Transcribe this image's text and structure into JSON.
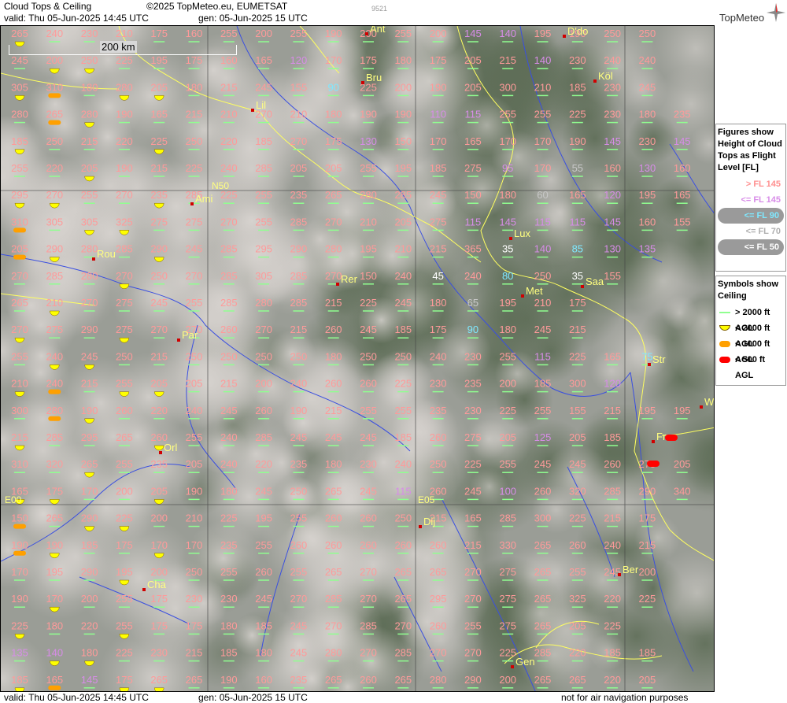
{
  "header": {
    "product": "Cloud Tops & Ceiling",
    "copyright": "©2025 TopMeteo.eu, EUMETSAT",
    "valid": "valid:  Thu  05-Jun-2025  14:45 UTC",
    "gen": "gen: 05-Jun-2025 15 UTC",
    "code": "9521",
    "logo": "TopMeteo"
  },
  "footer": {
    "valid": "valid:  Thu  05-Jun-2025  14:45 UTC",
    "gen": "gen: 05-Jun-2025 15 UTC",
    "disclaimer": "not for air navigation purposes"
  },
  "scale_label": "200 km",
  "grid_labels": {
    "n50": "N50",
    "e00": "E00",
    "e05": "E05"
  },
  "cities": [
    "Ant",
    "D'do",
    "Bru",
    "Köl",
    "Lil",
    "Ami",
    "Lux",
    "Rou",
    "Rer",
    "Saa",
    "Met",
    "Par",
    "Str",
    "W",
    "Fr",
    "Orl",
    "Dij",
    "Cha",
    "Ber",
    "Gen"
  ],
  "legend": {
    "tops_title": "Figures show Height of Cloud Tops as Flight Level  [FL]",
    "tops_items": [
      {
        "label": "> FL 145",
        "color": "#ff9090"
      },
      {
        "label": "<= FL 145",
        "color": "#d88ce8"
      },
      {
        "label": "<= FL 90",
        "color": "#7fe8ff"
      },
      {
        "label": "<= FL 70",
        "color": "#b0b0b0"
      },
      {
        "label": "<= FL 50",
        "color": "#ffffff"
      }
    ],
    "ceiling_title": "Symbols show Ceiling",
    "ceiling_items": [
      {
        "label": "> 2000 ft AGL",
        "color": "#90ff90",
        "shape": "line"
      },
      {
        "label": "< 2000 ft AGL",
        "color": "#ffff00",
        "shape": "half"
      },
      {
        "label": "< 1000 ft AGL",
        "color": "#ffa000",
        "shape": "pill"
      },
      {
        "label": "< 500 ft AGL",
        "color": "#ff0000",
        "shape": "pill"
      }
    ]
  },
  "rows": [
    [
      "265",
      "240",
      "230",
      "210",
      "175",
      "160",
      "255",
      "200",
      "255",
      "190",
      "200",
      "255",
      "200",
      "145",
      "140",
      "195",
      "190",
      "250",
      "250"
    ],
    [
      "245",
      "200",
      "250",
      "225",
      "195",
      "175",
      "160",
      "165",
      "120",
      "170",
      "175",
      "180",
      "175",
      "205",
      "215",
      "140",
      "230",
      "240",
      "240"
    ],
    [
      "305",
      "310",
      "180",
      "280",
      "205",
      "180",
      "215",
      "245",
      "155",
      "90",
      "225",
      "200",
      "190",
      "205",
      "300",
      "210",
      "185",
      "230",
      "245"
    ],
    [
      "280",
      "265",
      "280",
      "190",
      "165",
      "215",
      "210",
      "270",
      "210",
      "180",
      "190",
      "190",
      "110",
      "115",
      "255",
      "255",
      "225",
      "230",
      "180",
      "235"
    ],
    [
      "185",
      "250",
      "215",
      "220",
      "225",
      "250",
      "220",
      "185",
      "270",
      "175",
      "130",
      "150",
      "170",
      "165",
      "170",
      "170",
      "190",
      "145",
      "230",
      "145"
    ],
    [
      "255",
      "220",
      "205",
      "190",
      "215",
      "225",
      "240",
      "285",
      "205",
      "205",
      "255",
      "195",
      "185",
      "275",
      "95",
      "170",
      "55",
      "160",
      "130",
      "160"
    ],
    [
      "295",
      "270",
      "255",
      "270",
      "235",
      "285",
      "225",
      "255",
      "235",
      "265",
      "280",
      "285",
      "245",
      "150",
      "180",
      "60",
      "165",
      "120",
      "195",
      "165"
    ],
    [
      "310",
      "305",
      "305",
      "325",
      "275",
      "275",
      "270",
      "255",
      "285",
      "270",
      "210",
      "205",
      "275",
      "115",
      "145",
      "115",
      "115",
      "145",
      "160",
      "155"
    ],
    [
      "205",
      "290",
      "280",
      "285",
      "290",
      "245",
      "285",
      "295",
      "290",
      "280",
      "195",
      "210",
      "215",
      "365",
      "35",
      "140",
      "85",
      "130",
      "135"
    ],
    [
      "270",
      "285",
      "280",
      "270",
      "250",
      "270",
      "285",
      "305",
      "285",
      "270",
      "150",
      "240",
      "45",
      "240",
      "80",
      "250",
      "35",
      "155"
    ],
    [
      "265",
      "210",
      "270",
      "275",
      "245",
      "255",
      "285",
      "280",
      "285",
      "215",
      "225",
      "245",
      "180",
      "65",
      "195",
      "210",
      "175"
    ],
    [
      "270",
      "275",
      "290",
      "275",
      "270",
      "270",
      "260",
      "270",
      "215",
      "260",
      "245",
      "185",
      "175",
      "90",
      "180",
      "245",
      "215"
    ],
    [
      "255",
      "240",
      "245",
      "250",
      "215",
      "250",
      "250",
      "250",
      "250",
      "180",
      "250",
      "250",
      "240",
      "230",
      "255",
      "115",
      "225",
      "165",
      "75"
    ],
    [
      "210",
      "240",
      "215",
      "255",
      "205",
      "205",
      "215",
      "200",
      "240",
      "260",
      "260",
      "225",
      "230",
      "235",
      "200",
      "185",
      "300",
      "120"
    ],
    [
      "300",
      "280",
      "190",
      "260",
      "220",
      "240",
      "245",
      "260",
      "190",
      "215",
      "255",
      "255",
      "235",
      "230",
      "225",
      "255",
      "155",
      "215",
      "195",
      "195"
    ],
    [
      "215",
      "285",
      "295",
      "265",
      "260",
      "255",
      "240",
      "285",
      "245",
      "245",
      "245",
      "185",
      "260",
      "275",
      "205",
      "125",
      "205",
      "185"
    ],
    [
      "310",
      "320",
      "265",
      "255",
      "235",
      "205",
      "240",
      "220",
      "235",
      "180",
      "230",
      "240",
      "250",
      "225",
      "255",
      "245",
      "245",
      "260",
      "275",
      "205",
      "200"
    ],
    [
      "165",
      "175",
      "170",
      "200",
      "205",
      "190",
      "180",
      "245",
      "250",
      "265",
      "245",
      "115",
      "260",
      "245",
      "100",
      "260",
      "320",
      "285",
      "290",
      "340",
      "220"
    ],
    [
      "150",
      "265",
      "290",
      "225",
      "200",
      "210",
      "225",
      "195",
      "255",
      "260",
      "260",
      "250",
      "215",
      "165",
      "285",
      "300",
      "225",
      "215",
      "175"
    ],
    [
      "190",
      "190",
      "185",
      "175",
      "170",
      "170",
      "235",
      "255",
      "260",
      "260",
      "260",
      "260",
      "260",
      "215",
      "330",
      "265",
      "260",
      "240",
      "215"
    ],
    [
      "170",
      "195",
      "290",
      "195",
      "200",
      "250",
      "255",
      "260",
      "255",
      "265",
      "270",
      "265",
      "265",
      "270",
      "275",
      "265",
      "255",
      "245",
      "200"
    ],
    [
      "190",
      "170",
      "200",
      "255",
      "175",
      "230",
      "230",
      "245",
      "270",
      "285",
      "270",
      "265",
      "295",
      "270",
      "275",
      "265",
      "325",
      "220",
      "225"
    ],
    [
      "225",
      "180",
      "220",
      "255",
      "175",
      "175",
      "180",
      "185",
      "245",
      "270",
      "285",
      "270",
      "260",
      "255",
      "275",
      "265",
      "205",
      "225"
    ],
    [
      "135",
      "140",
      "180",
      "225",
      "230",
      "215",
      "185",
      "180",
      "245",
      "280",
      "270",
      "285",
      "270",
      "270",
      "225",
      "285",
      "220",
      "185",
      "185"
    ],
    [
      "185",
      "165",
      "145",
      "175",
      "265",
      "265",
      "190",
      "160",
      "235",
      "265",
      "260",
      "265",
      "280",
      "290",
      "200",
      "265",
      "265",
      "220",
      "205"
    ]
  ]
}
